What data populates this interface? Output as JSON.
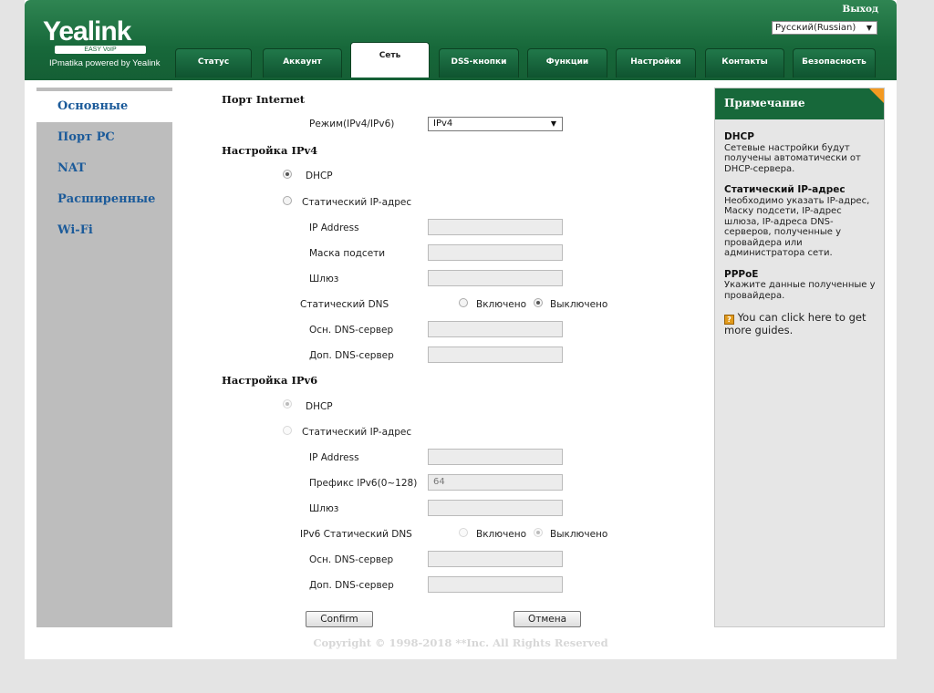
{
  "header": {
    "logo": "Yealink",
    "logo_sub": "EASY VoIP",
    "powered": "IPmatika powered by Yealink",
    "logout": "Выход",
    "language": "Русский(Russian)"
  },
  "tabs": [
    {
      "label": "Статус"
    },
    {
      "label": "Аккаунт"
    },
    {
      "label": "Сеть"
    },
    {
      "label": "DSS-кнопки"
    },
    {
      "label": "Функции"
    },
    {
      "label": "Настройки"
    },
    {
      "label": "Контакты"
    },
    {
      "label": "Безопасность"
    }
  ],
  "active_tab": "Сеть",
  "sidebar": {
    "items": [
      {
        "label": "Основные"
      },
      {
        "label": "Порт PC"
      },
      {
        "label": "NAT"
      },
      {
        "label": "Расширенные"
      },
      {
        "label": "Wi-Fi"
      }
    ],
    "active": "Основные"
  },
  "form": {
    "port_heading": "Порт Internet",
    "mode_label": "Режим(IPv4/IPv6)",
    "mode_value": "IPv4",
    "ipv4": {
      "heading": "Настройка IPv4",
      "dhcp_label": "DHCP",
      "dhcp_selected": true,
      "static_label": "Статический IP-адрес",
      "ip_label": "IP Address",
      "ip_value": "",
      "mask_label": "Маска подсети",
      "mask_value": "",
      "gateway_label": "Шлюз",
      "gateway_value": "",
      "static_dns_label": "Статический DNS",
      "on_label": "Включено",
      "off_label": "Выключено",
      "static_dns_enabled": false,
      "primary_dns_label": "Осн. DNS-сервер",
      "primary_dns_value": "",
      "secondary_dns_label": "Доп. DNS-сервер",
      "secondary_dns_value": ""
    },
    "ipv6": {
      "heading": "Настройка IPv6",
      "dhcp_label": "DHCP",
      "dhcp_selected": true,
      "static_label": "Статический IP-адрес",
      "ip_label": "IP Address",
      "ip_value": "",
      "prefix_label": "Префикс IPv6(0~128)",
      "prefix_value": "64",
      "gateway_label": "Шлюз",
      "gateway_value": "",
      "static_dns_label": "IPv6 Статический DNS",
      "on_label": "Включено",
      "off_label": "Выключено",
      "static_dns_enabled": false,
      "primary_dns_label": "Осн. DNS-сервер",
      "primary_dns_value": "",
      "secondary_dns_label": "Доп. DNS-сервер",
      "secondary_dns_value": ""
    },
    "confirm_label": "Confirm",
    "cancel_label": "Отмена"
  },
  "note": {
    "title": "Примечание",
    "sections": [
      {
        "title": "DHCP",
        "text": "Сетевые настройки будут получены автоматически от DHCP-сервера."
      },
      {
        "title": "Статический IP-адрес",
        "text": "Необходимо указать IP-адрес, Маску подсети, IP-адрес шлюза, IP-адреса DNS-серверов, полученные у провайдера или администратора сети."
      },
      {
        "title": "PPPoE",
        "text": "Укажите данные полученные у провайдера."
      }
    ],
    "guide_text": "You can click here to get more guides."
  },
  "footer": {
    "copyright": "Copyright © 1998-2018 **Inc. All Rights Reserved"
  },
  "colors": {
    "brand_green": "#17683a",
    "accent_orange": "#f39a22",
    "link_blue": "#1c5b9a"
  }
}
